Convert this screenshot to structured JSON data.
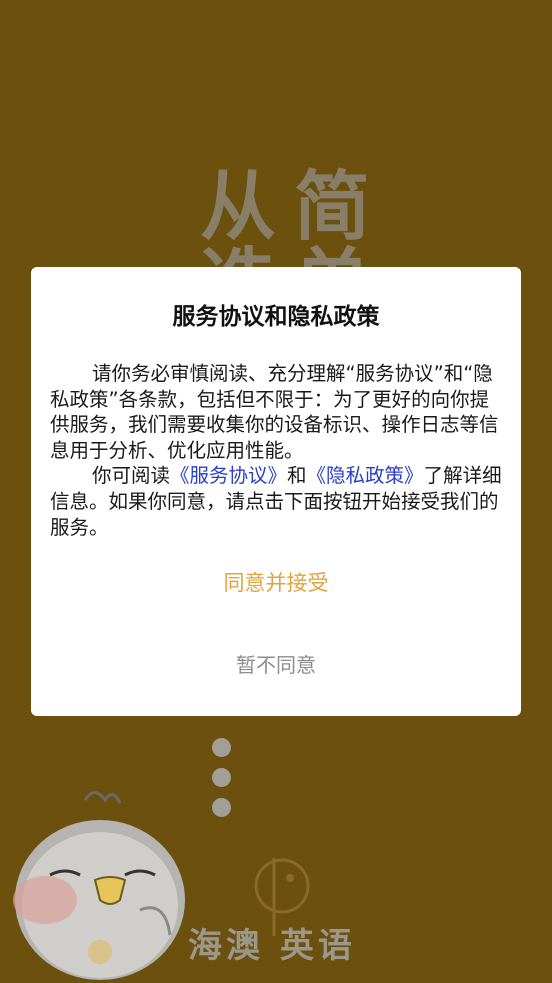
{
  "background": {
    "slogan_line1": "从简",
    "slogan_line2": "选单",
    "brand_name": "海澳 英语",
    "colors": {
      "bg": "#6b500e",
      "faint": "#8f887a"
    }
  },
  "dialog": {
    "title": "服务协议和隐私政策",
    "para1": "请你务必审慎阅读、充分理解“服务协议”和“隐私政策”各条款，包括但不限于：为了更好的向你提供服务，我们需要收集你的设备标识、操作日志等信息用于分析、优化应用性能。",
    "para2_prefix": "你可阅读",
    "link_service": "《服务协议》",
    "para2_and": "和",
    "link_privacy": "《隐私政策》",
    "para2_suffix": "了解详细信息。如果你同意，请点击下面按钮开始接受我们的服务。",
    "accept_label": "同意并接受",
    "decline_label": "暂不同意",
    "colors": {
      "accent": "#e3a33c",
      "link": "#2a3ec9",
      "muted": "#8c8c8c"
    }
  }
}
